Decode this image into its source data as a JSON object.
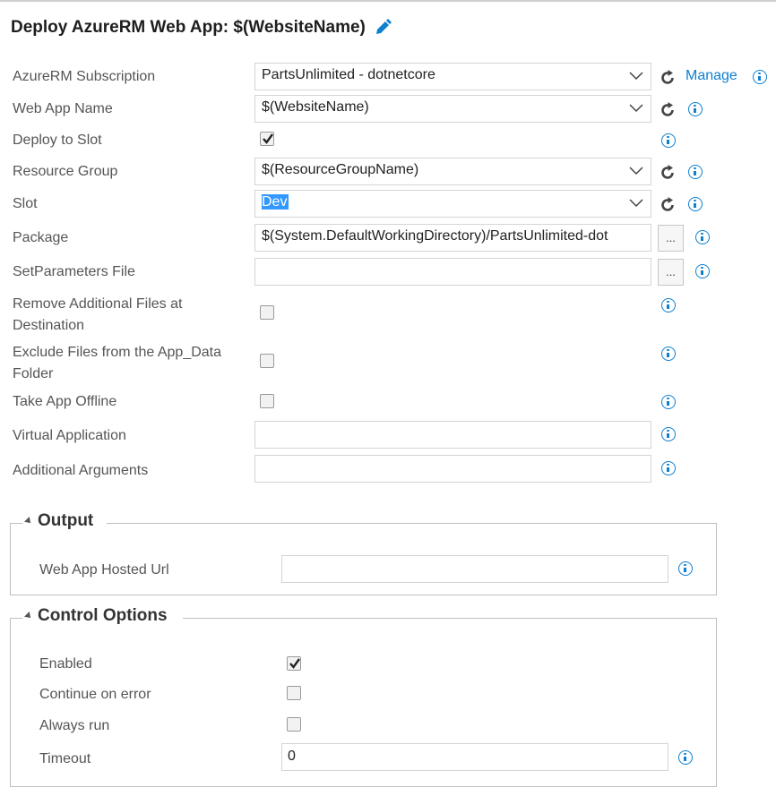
{
  "title": "Deploy AzureRM Web App: $(WebsiteName)",
  "fields": {
    "subscription": {
      "label": "AzureRM Subscription",
      "value": "PartsUnlimited - dotnetcore",
      "manage": "Manage"
    },
    "web_app_name": {
      "label": "Web App Name",
      "value": "$(WebsiteName)"
    },
    "deploy_to_slot": {
      "label": "Deploy to Slot",
      "checked": true
    },
    "resource_group": {
      "label": "Resource Group",
      "value": "$(ResourceGroupName)"
    },
    "slot": {
      "label": "Slot",
      "value": "Dev"
    },
    "package": {
      "label": "Package",
      "value": "$(System.DefaultWorkingDirectory)/PartsUnlimited-dot",
      "browse": "..."
    },
    "setparameters": {
      "label": "SetParameters File",
      "value": "",
      "browse": "..."
    },
    "remove_files": {
      "label_line1": "Remove Additional Files at",
      "label_line2": "Destination",
      "checked": false
    },
    "exclude_app_data": {
      "label_line1": "Exclude Files from the App_Data",
      "label_line2": "Folder",
      "checked": false
    },
    "take_offline": {
      "label": "Take App Offline",
      "checked": false
    },
    "virtual_application": {
      "label": "Virtual Application",
      "value": ""
    },
    "additional_arguments": {
      "label": "Additional Arguments",
      "value": ""
    }
  },
  "output": {
    "title": "Output",
    "hosted_url": {
      "label": "Web App Hosted Url",
      "value": ""
    }
  },
  "control_options": {
    "title": "Control Options",
    "enabled": {
      "label": "Enabled",
      "checked": true
    },
    "continue_on_error": {
      "label": "Continue on error",
      "checked": false
    },
    "always_run": {
      "label": "Always run",
      "checked": false
    },
    "timeout": {
      "label": "Timeout",
      "value": "0"
    }
  },
  "colors": {
    "accent": "#0d7fd0",
    "selection": "#3399ff",
    "border": "#d4d4d4"
  },
  "icons": [
    "pencil-icon",
    "refresh-icon",
    "info-icon",
    "chevron-down-icon",
    "check-icon",
    "collapse-triangle-icon"
  ]
}
